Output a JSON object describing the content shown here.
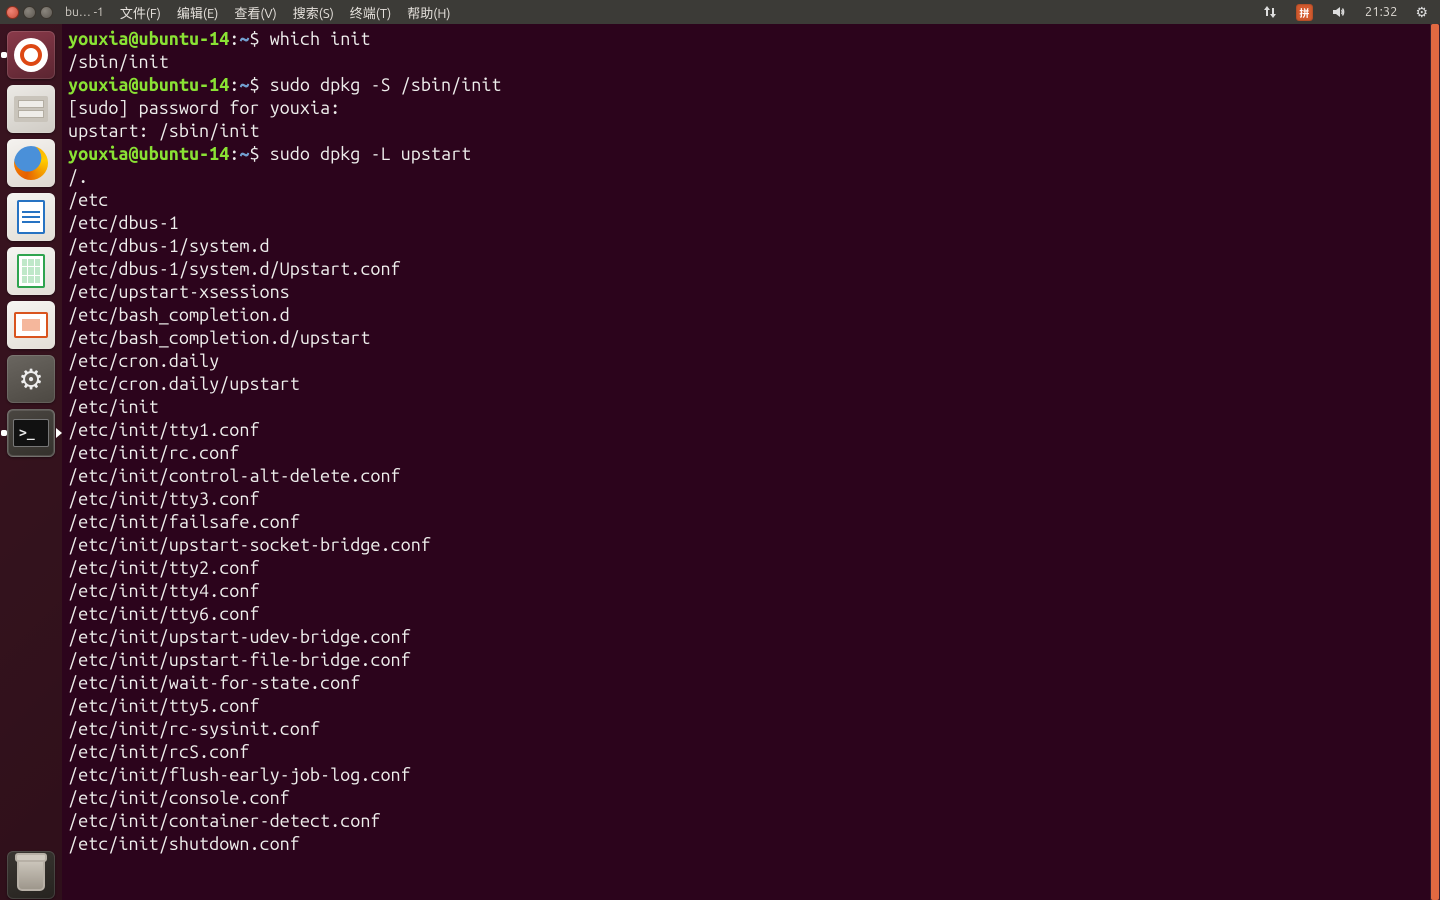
{
  "panel": {
    "title_fragment": "bu… -1",
    "menus": [
      "文件(F)",
      "编辑(E)",
      "查看(V)",
      "搜索(S)",
      "终端(T)",
      "帮助(H)"
    ],
    "clock": "21:32",
    "input_method_badge": "拼"
  },
  "launcher": {
    "items": [
      {
        "name": "dash",
        "label": "Dash"
      },
      {
        "name": "files",
        "label": "Files"
      },
      {
        "name": "firefox",
        "label": "Firefox"
      },
      {
        "name": "writer",
        "label": "LibreOffice Writer"
      },
      {
        "name": "calc",
        "label": "LibreOffice Calc"
      },
      {
        "name": "impress",
        "label": "LibreOffice Impress"
      },
      {
        "name": "settings",
        "label": "System Settings"
      },
      {
        "name": "terminal",
        "label": "Terminal"
      }
    ],
    "trash_label": "Trash"
  },
  "terminal": {
    "prompt_user": "youxia@ubuntu-14",
    "prompt_path": "~",
    "lines": [
      {
        "t": "cmd",
        "cmd": "which init"
      },
      {
        "t": "out",
        "text": "/sbin/init"
      },
      {
        "t": "cmd",
        "cmd": "sudo dpkg -S /sbin/init"
      },
      {
        "t": "out",
        "text": "[sudo] password for youxia:"
      },
      {
        "t": "out",
        "text": "upstart: /sbin/init"
      },
      {
        "t": "cmd",
        "cmd": "sudo dpkg -L upstart"
      },
      {
        "t": "out",
        "text": "/."
      },
      {
        "t": "out",
        "text": "/etc"
      },
      {
        "t": "out",
        "text": "/etc/dbus-1"
      },
      {
        "t": "out",
        "text": "/etc/dbus-1/system.d"
      },
      {
        "t": "out",
        "text": "/etc/dbus-1/system.d/Upstart.conf"
      },
      {
        "t": "out",
        "text": "/etc/upstart-xsessions"
      },
      {
        "t": "out",
        "text": "/etc/bash_completion.d"
      },
      {
        "t": "out",
        "text": "/etc/bash_completion.d/upstart"
      },
      {
        "t": "out",
        "text": "/etc/cron.daily"
      },
      {
        "t": "out",
        "text": "/etc/cron.daily/upstart"
      },
      {
        "t": "out",
        "text": "/etc/init"
      },
      {
        "t": "out",
        "text": "/etc/init/tty1.conf"
      },
      {
        "t": "out",
        "text": "/etc/init/rc.conf"
      },
      {
        "t": "out",
        "text": "/etc/init/control-alt-delete.conf"
      },
      {
        "t": "out",
        "text": "/etc/init/tty3.conf"
      },
      {
        "t": "out",
        "text": "/etc/init/failsafe.conf"
      },
      {
        "t": "out",
        "text": "/etc/init/upstart-socket-bridge.conf"
      },
      {
        "t": "out",
        "text": "/etc/init/tty2.conf"
      },
      {
        "t": "out",
        "text": "/etc/init/tty4.conf"
      },
      {
        "t": "out",
        "text": "/etc/init/tty6.conf"
      },
      {
        "t": "out",
        "text": "/etc/init/upstart-udev-bridge.conf"
      },
      {
        "t": "out",
        "text": "/etc/init/upstart-file-bridge.conf"
      },
      {
        "t": "out",
        "text": "/etc/init/wait-for-state.conf"
      },
      {
        "t": "out",
        "text": "/etc/init/tty5.conf"
      },
      {
        "t": "out",
        "text": "/etc/init/rc-sysinit.conf"
      },
      {
        "t": "out",
        "text": "/etc/init/rcS.conf"
      },
      {
        "t": "out",
        "text": "/etc/init/flush-early-job-log.conf"
      },
      {
        "t": "out",
        "text": "/etc/init/console.conf"
      },
      {
        "t": "out",
        "text": "/etc/init/container-detect.conf"
      },
      {
        "t": "out",
        "text": "/etc/init/shutdown.conf"
      }
    ]
  }
}
